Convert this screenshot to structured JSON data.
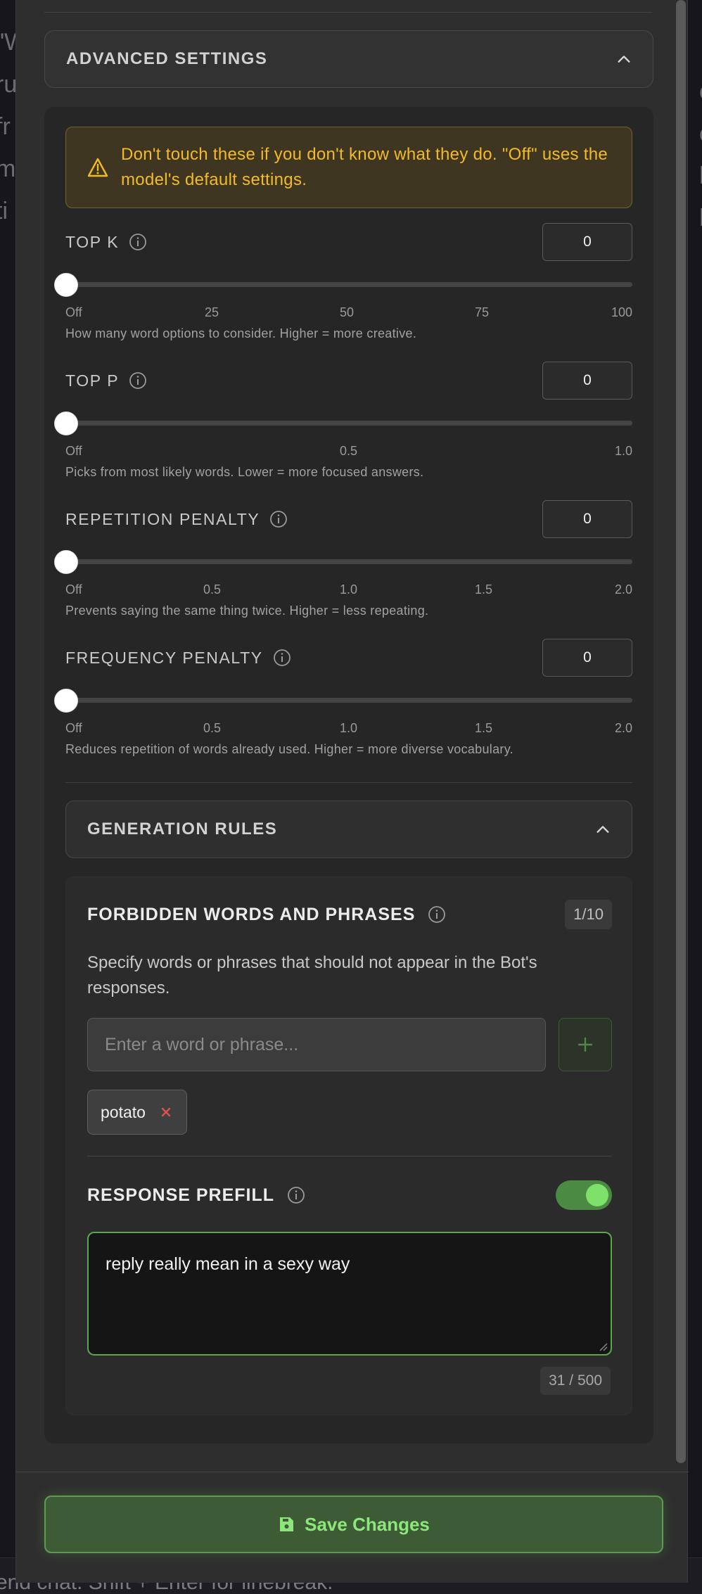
{
  "advanced": {
    "title": "ADVANCED SETTINGS",
    "warning": "Don't touch these if you don't know what they do. \"Off\" uses the model's default settings."
  },
  "params": {
    "top_k": {
      "label": "TOP K",
      "value": "0",
      "ticks": [
        "Off",
        "25",
        "50",
        "75",
        "100"
      ],
      "hint": "How many word options to consider. Higher = more creative."
    },
    "top_p": {
      "label": "TOP P",
      "value": "0",
      "ticks": [
        "Off",
        "0.5",
        "1.0"
      ],
      "hint": "Picks from most likely words. Lower = more focused answers."
    },
    "repetition": {
      "label": "REPETITION PENALTY",
      "value": "0",
      "ticks": [
        "Off",
        "0.5",
        "1.0",
        "1.5",
        "2.0"
      ],
      "hint": "Prevents saying the same thing twice. Higher = less repeating."
    },
    "frequency": {
      "label": "FREQUENCY PENALTY",
      "value": "0",
      "ticks": [
        "Off",
        "0.5",
        "1.0",
        "1.5",
        "2.0"
      ],
      "hint": "Reduces repetition of words already used. Higher = more diverse vocabulary."
    }
  },
  "generation": {
    "title": "GENERATION RULES",
    "forbidden": {
      "title": "FORBIDDEN WORDS AND PHRASES",
      "count": "1/10",
      "description": "Specify words or phrases that should not appear in the Bot's responses.",
      "placeholder": "Enter a word or phrase...",
      "chips": [
        "potato"
      ]
    },
    "prefill": {
      "title": "RESPONSE PREFILL",
      "enabled": true,
      "text": "reply really mean in a sexy way",
      "count": "31 / 500"
    }
  },
  "footer": {
    "save_label": "Save Changes"
  },
  "background": {
    "bottom_text": "end chat. Shift + Enter for linebreak."
  },
  "colors": {
    "accent": "#7ee26a",
    "warning": "#f2bb26",
    "danger": "#e0524f"
  }
}
